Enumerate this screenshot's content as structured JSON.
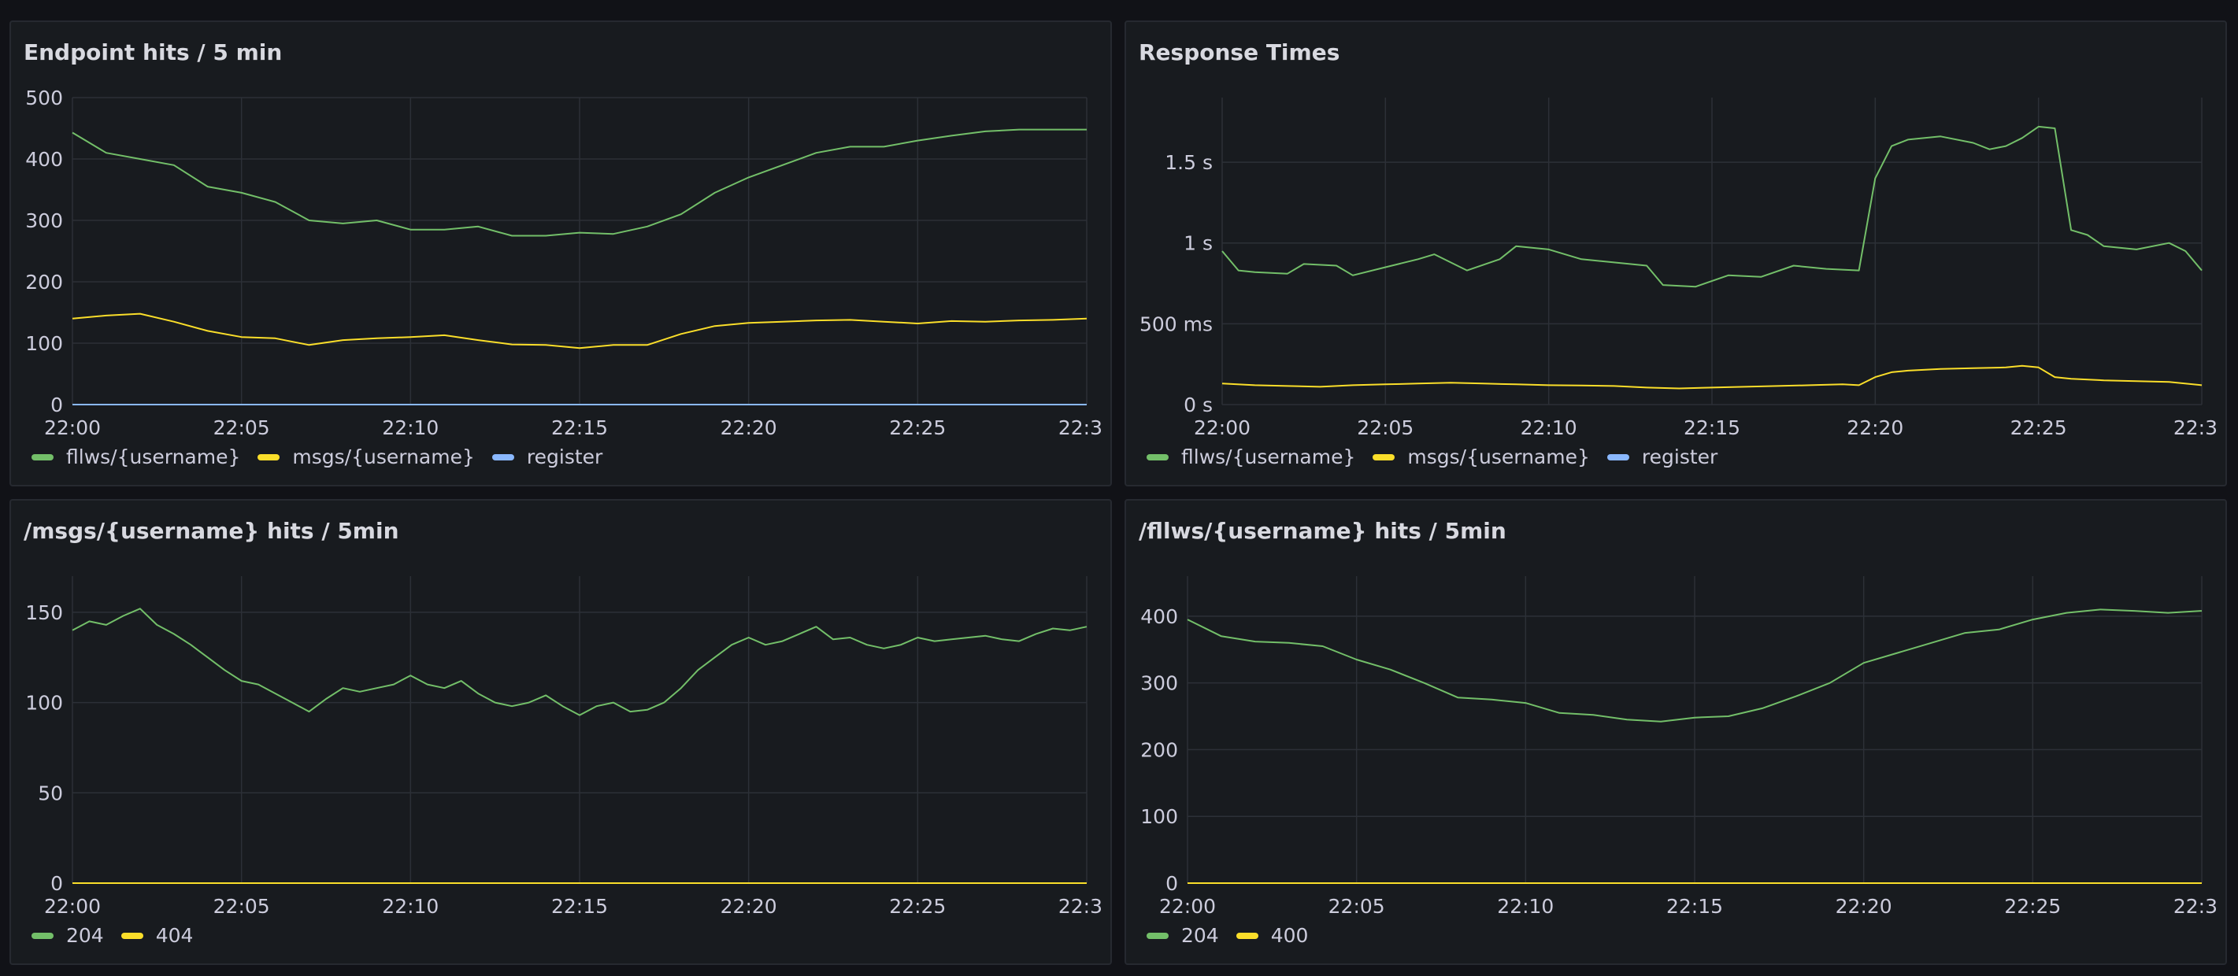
{
  "panels": [
    {
      "title": "Endpoint hits / 5 min"
    },
    {
      "title": "Response Times"
    },
    {
      "title": "/msgs/{username} hits / 5min"
    },
    {
      "title": "/fllws/{username} hits / 5min"
    }
  ],
  "chart_data": [
    {
      "type": "line",
      "title": "Endpoint hits / 5 min",
      "x_ticks": [
        "22:00",
        "22:05",
        "22:10",
        "22:15",
        "22:20",
        "22:25",
        "22:3"
      ],
      "y_ticks": [
        "0",
        "100",
        "200",
        "300",
        "400",
        "500"
      ],
      "y_tick_values": [
        0,
        100,
        200,
        300,
        400,
        500
      ],
      "xlim": [
        0,
        30
      ],
      "ylim": [
        0,
        500
      ],
      "grid": true,
      "legend_position": "bottom-left",
      "series": [
        {
          "name": "fllws/{username}",
          "color": "#73bf69",
          "x": [
            0,
            1,
            2,
            3,
            4,
            5,
            6,
            7,
            8,
            9,
            10,
            11,
            12,
            13,
            14,
            15,
            16,
            17,
            18,
            19,
            20,
            21,
            22,
            23,
            24,
            25,
            26,
            27,
            28,
            29,
            30
          ],
          "y": [
            443,
            410,
            400,
            390,
            355,
            345,
            330,
            300,
            295,
            300,
            285,
            285,
            290,
            275,
            275,
            280,
            278,
            290,
            310,
            345,
            370,
            390,
            410,
            420,
            420,
            430,
            438,
            445,
            448,
            448,
            448
          ]
        },
        {
          "name": "msgs/{username}",
          "color": "#fade2a",
          "x": [
            0,
            1,
            2,
            3,
            4,
            5,
            6,
            7,
            8,
            9,
            10,
            11,
            12,
            13,
            14,
            15,
            16,
            17,
            18,
            19,
            20,
            21,
            22,
            23,
            24,
            25,
            26,
            27,
            28,
            29,
            30
          ],
          "y": [
            140,
            145,
            148,
            135,
            120,
            110,
            108,
            97,
            105,
            108,
            110,
            113,
            105,
            98,
            97,
            92,
            97,
            97,
            115,
            128,
            133,
            135,
            137,
            138,
            135,
            132,
            136,
            135,
            137,
            138,
            140
          ]
        },
        {
          "name": "register",
          "color": "#8ab8ff",
          "x": [
            0,
            30
          ],
          "y": [
            0,
            0
          ]
        }
      ]
    },
    {
      "type": "line",
      "title": "Response Times",
      "x_ticks": [
        "22:00",
        "22:05",
        "22:10",
        "22:15",
        "22:20",
        "22:25",
        "22:3"
      ],
      "y_ticks": [
        "0 s",
        "500 ms",
        "1 s",
        "1.5 s"
      ],
      "y_tick_values": [
        0,
        500,
        1000,
        1500
      ],
      "xlim": [
        0,
        30
      ],
      "ylim": [
        0,
        1900
      ],
      "grid": true,
      "legend_position": "bottom-left",
      "series": [
        {
          "name": "fllws/{username}",
          "color": "#73bf69",
          "x": [
            0,
            0.5,
            1,
            2,
            2.5,
            3.5,
            4,
            5,
            6,
            6.5,
            7.5,
            8.5,
            9,
            10,
            11,
            12,
            13,
            13.5,
            14.5,
            15.5,
            16.5,
            17.5,
            18.5,
            19.5,
            20,
            20.5,
            21,
            22,
            23,
            23.5,
            24,
            24.5,
            25,
            25.5,
            26,
            26.5,
            27,
            28,
            29,
            29.5,
            30
          ],
          "y": [
            950,
            830,
            820,
            810,
            870,
            860,
            800,
            850,
            900,
            930,
            830,
            900,
            980,
            960,
            900,
            880,
            860,
            740,
            730,
            800,
            790,
            860,
            840,
            830,
            1400,
            1600,
            1640,
            1660,
            1620,
            1580,
            1600,
            1650,
            1720,
            1710,
            1080,
            1050,
            980,
            960,
            1000,
            950,
            830
          ]
        },
        {
          "name": "msgs/{username}",
          "color": "#fade2a",
          "x": [
            0,
            1,
            2,
            3,
            4,
            5,
            6,
            7,
            8,
            9,
            10,
            11,
            12,
            13,
            14,
            15,
            16,
            17,
            18,
            19,
            19.5,
            20,
            20.5,
            21,
            22,
            23,
            24,
            24.5,
            25,
            25.5,
            26,
            27,
            28,
            29,
            30
          ],
          "y": [
            130,
            120,
            115,
            110,
            120,
            125,
            130,
            135,
            130,
            125,
            120,
            118,
            115,
            105,
            100,
            105,
            110,
            115,
            120,
            125,
            120,
            170,
            200,
            210,
            220,
            225,
            230,
            240,
            230,
            170,
            160,
            150,
            145,
            140,
            120
          ]
        },
        {
          "name": "register",
          "color": "#8ab8ff",
          "x": [],
          "y": []
        }
      ]
    },
    {
      "type": "line",
      "title": "/msgs/{username} hits / 5min",
      "x_ticks": [
        "22:00",
        "22:05",
        "22:10",
        "22:15",
        "22:20",
        "22:25",
        "22:3"
      ],
      "y_ticks": [
        "0",
        "50",
        "100",
        "150"
      ],
      "y_tick_values": [
        0,
        50,
        100,
        150
      ],
      "xlim": [
        0,
        30
      ],
      "ylim": [
        0,
        170
      ],
      "grid": true,
      "legend_position": "bottom-left",
      "series": [
        {
          "name": "204",
          "color": "#73bf69",
          "x": [
            0,
            0.5,
            1,
            1.5,
            2,
            2.5,
            3,
            3.5,
            4,
            4.5,
            5,
            5.5,
            6,
            6.5,
            7,
            7.5,
            8,
            8.5,
            9,
            9.5,
            10,
            10.5,
            11,
            11.5,
            12,
            12.5,
            13,
            13.5,
            14,
            14.5,
            15,
            15.5,
            16,
            16.5,
            17,
            17.5,
            18,
            18.5,
            19,
            19.5,
            20,
            20.5,
            21,
            21.5,
            22,
            22.5,
            23,
            23.5,
            24,
            24.5,
            25,
            25.5,
            26,
            26.5,
            27,
            27.5,
            28,
            28.5,
            29,
            29.5,
            30
          ],
          "y": [
            140,
            145,
            143,
            148,
            152,
            143,
            138,
            132,
            125,
            118,
            112,
            110,
            105,
            100,
            95,
            102,
            108,
            106,
            108,
            110,
            115,
            110,
            108,
            112,
            105,
            100,
            98,
            100,
            104,
            98,
            93,
            98,
            100,
            95,
            96,
            100,
            108,
            118,
            125,
            132,
            136,
            132,
            134,
            138,
            142,
            135,
            136,
            132,
            130,
            132,
            136,
            134,
            135,
            136,
            137,
            135,
            134,
            138,
            141,
            140,
            142
          ]
        },
        {
          "name": "404",
          "color": "#fade2a",
          "x": [
            0,
            30
          ],
          "y": [
            0,
            0
          ]
        }
      ]
    },
    {
      "type": "line",
      "title": "/fllws/{username} hits / 5min",
      "x_ticks": [
        "22:00",
        "22:05",
        "22:10",
        "22:15",
        "22:20",
        "22:25",
        "22:3"
      ],
      "y_ticks": [
        "0",
        "100",
        "200",
        "300",
        "400"
      ],
      "y_tick_values": [
        0,
        100,
        200,
        300,
        400
      ],
      "xlim": [
        0,
        30
      ],
      "ylim": [
        0,
        460
      ],
      "grid": true,
      "legend_position": "bottom-left",
      "series": [
        {
          "name": "204",
          "color": "#73bf69",
          "x": [
            0,
            1,
            2,
            3,
            4,
            5,
            6,
            7,
            8,
            9,
            10,
            11,
            12,
            13,
            14,
            15,
            16,
            17,
            18,
            19,
            20,
            21,
            22,
            23,
            24,
            25,
            26,
            27,
            28,
            29,
            30
          ],
          "y": [
            395,
            370,
            362,
            360,
            355,
            335,
            320,
            300,
            278,
            275,
            270,
            255,
            252,
            245,
            242,
            248,
            250,
            262,
            280,
            300,
            330,
            345,
            360,
            375,
            380,
            395,
            405,
            410,
            408,
            405,
            408
          ]
        },
        {
          "name": "400",
          "color": "#fade2a",
          "x": [
            0,
            30
          ],
          "y": [
            0,
            0
          ]
        }
      ]
    }
  ]
}
